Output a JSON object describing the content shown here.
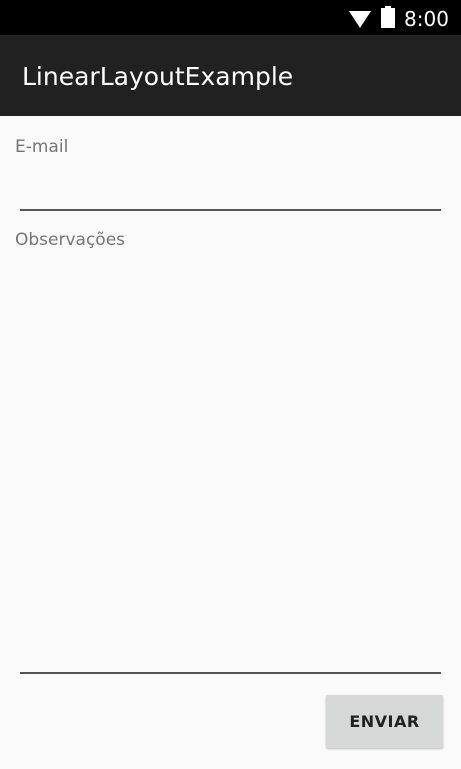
{
  "status_bar": {
    "time": "8:00",
    "wifi_icon": "wifi-icon",
    "battery_icon": "battery-icon"
  },
  "app_bar": {
    "title": "LinearLayoutExample"
  },
  "form": {
    "email_label": "E-mail",
    "email_value": "",
    "observacoes_label": "Observações",
    "observacoes_value": "",
    "submit_label": "ENVIAR"
  },
  "colors": {
    "status_bar": "#000000",
    "app_bar": "#212121",
    "background": "#fafafa",
    "label_text": "#757575",
    "button_bg": "#d6d7d7"
  }
}
